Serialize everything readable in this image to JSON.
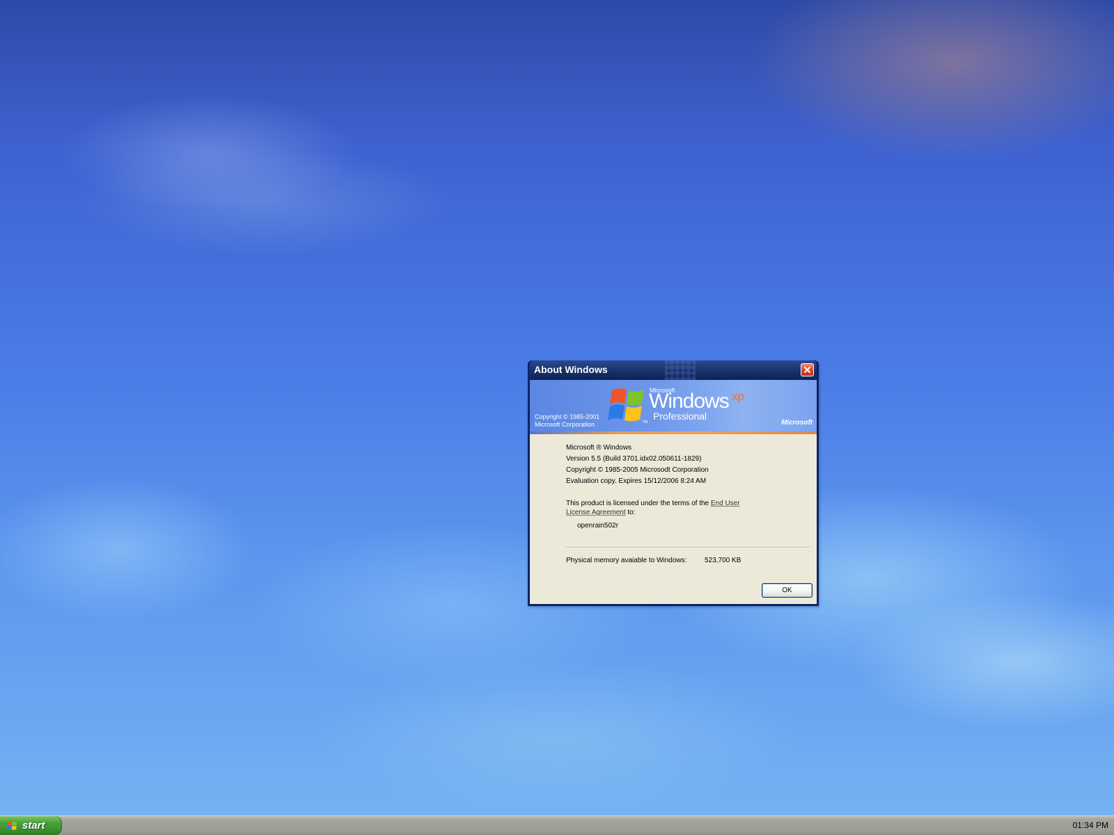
{
  "dialog": {
    "title": "About Windows",
    "close_icon": "close-icon",
    "banner": {
      "copyright_line1": "Copyright © 1985-2001",
      "copyright_line2": "Microsoft Corporation",
      "logo_microsoft": "Microsoft",
      "logo_windows": "Windows",
      "logo_xp": "xp",
      "logo_edition": "Professional",
      "brand": "Microsoft",
      "logo_icon": "windows-flag-icon"
    },
    "body": {
      "product": "Microsoft ® Windows",
      "version": "Version 5.5 (Build 3701.idx02.050611-1829)",
      "copyright": "Copyright © 1985-2005 Microsodt Corporation",
      "evaluation": "Evaluation copy. Expires 15/12/2006 8:24 AM",
      "license_text": "This product is licensed under the terms of the",
      "eula_link_part1": "End User",
      "eula_link_part2": "License Agreement",
      "license_to": "to:",
      "licensee": "openrain502r",
      "memory_label": "Physical memory avaiable to Windows:",
      "memory_value": "523,700 KB"
    },
    "ok_label": "OK"
  },
  "taskbar": {
    "start_label": "start",
    "start_icon": "windows-flag-icon",
    "clock": "01:34 PM"
  },
  "colors": {
    "titlebar": "#1b3570",
    "close_button": "#d8442a",
    "banner": "#6f98ea",
    "dialog_body": "#ece9d8",
    "start_button": "#46a33a",
    "taskbar": "#a4a59f"
  }
}
